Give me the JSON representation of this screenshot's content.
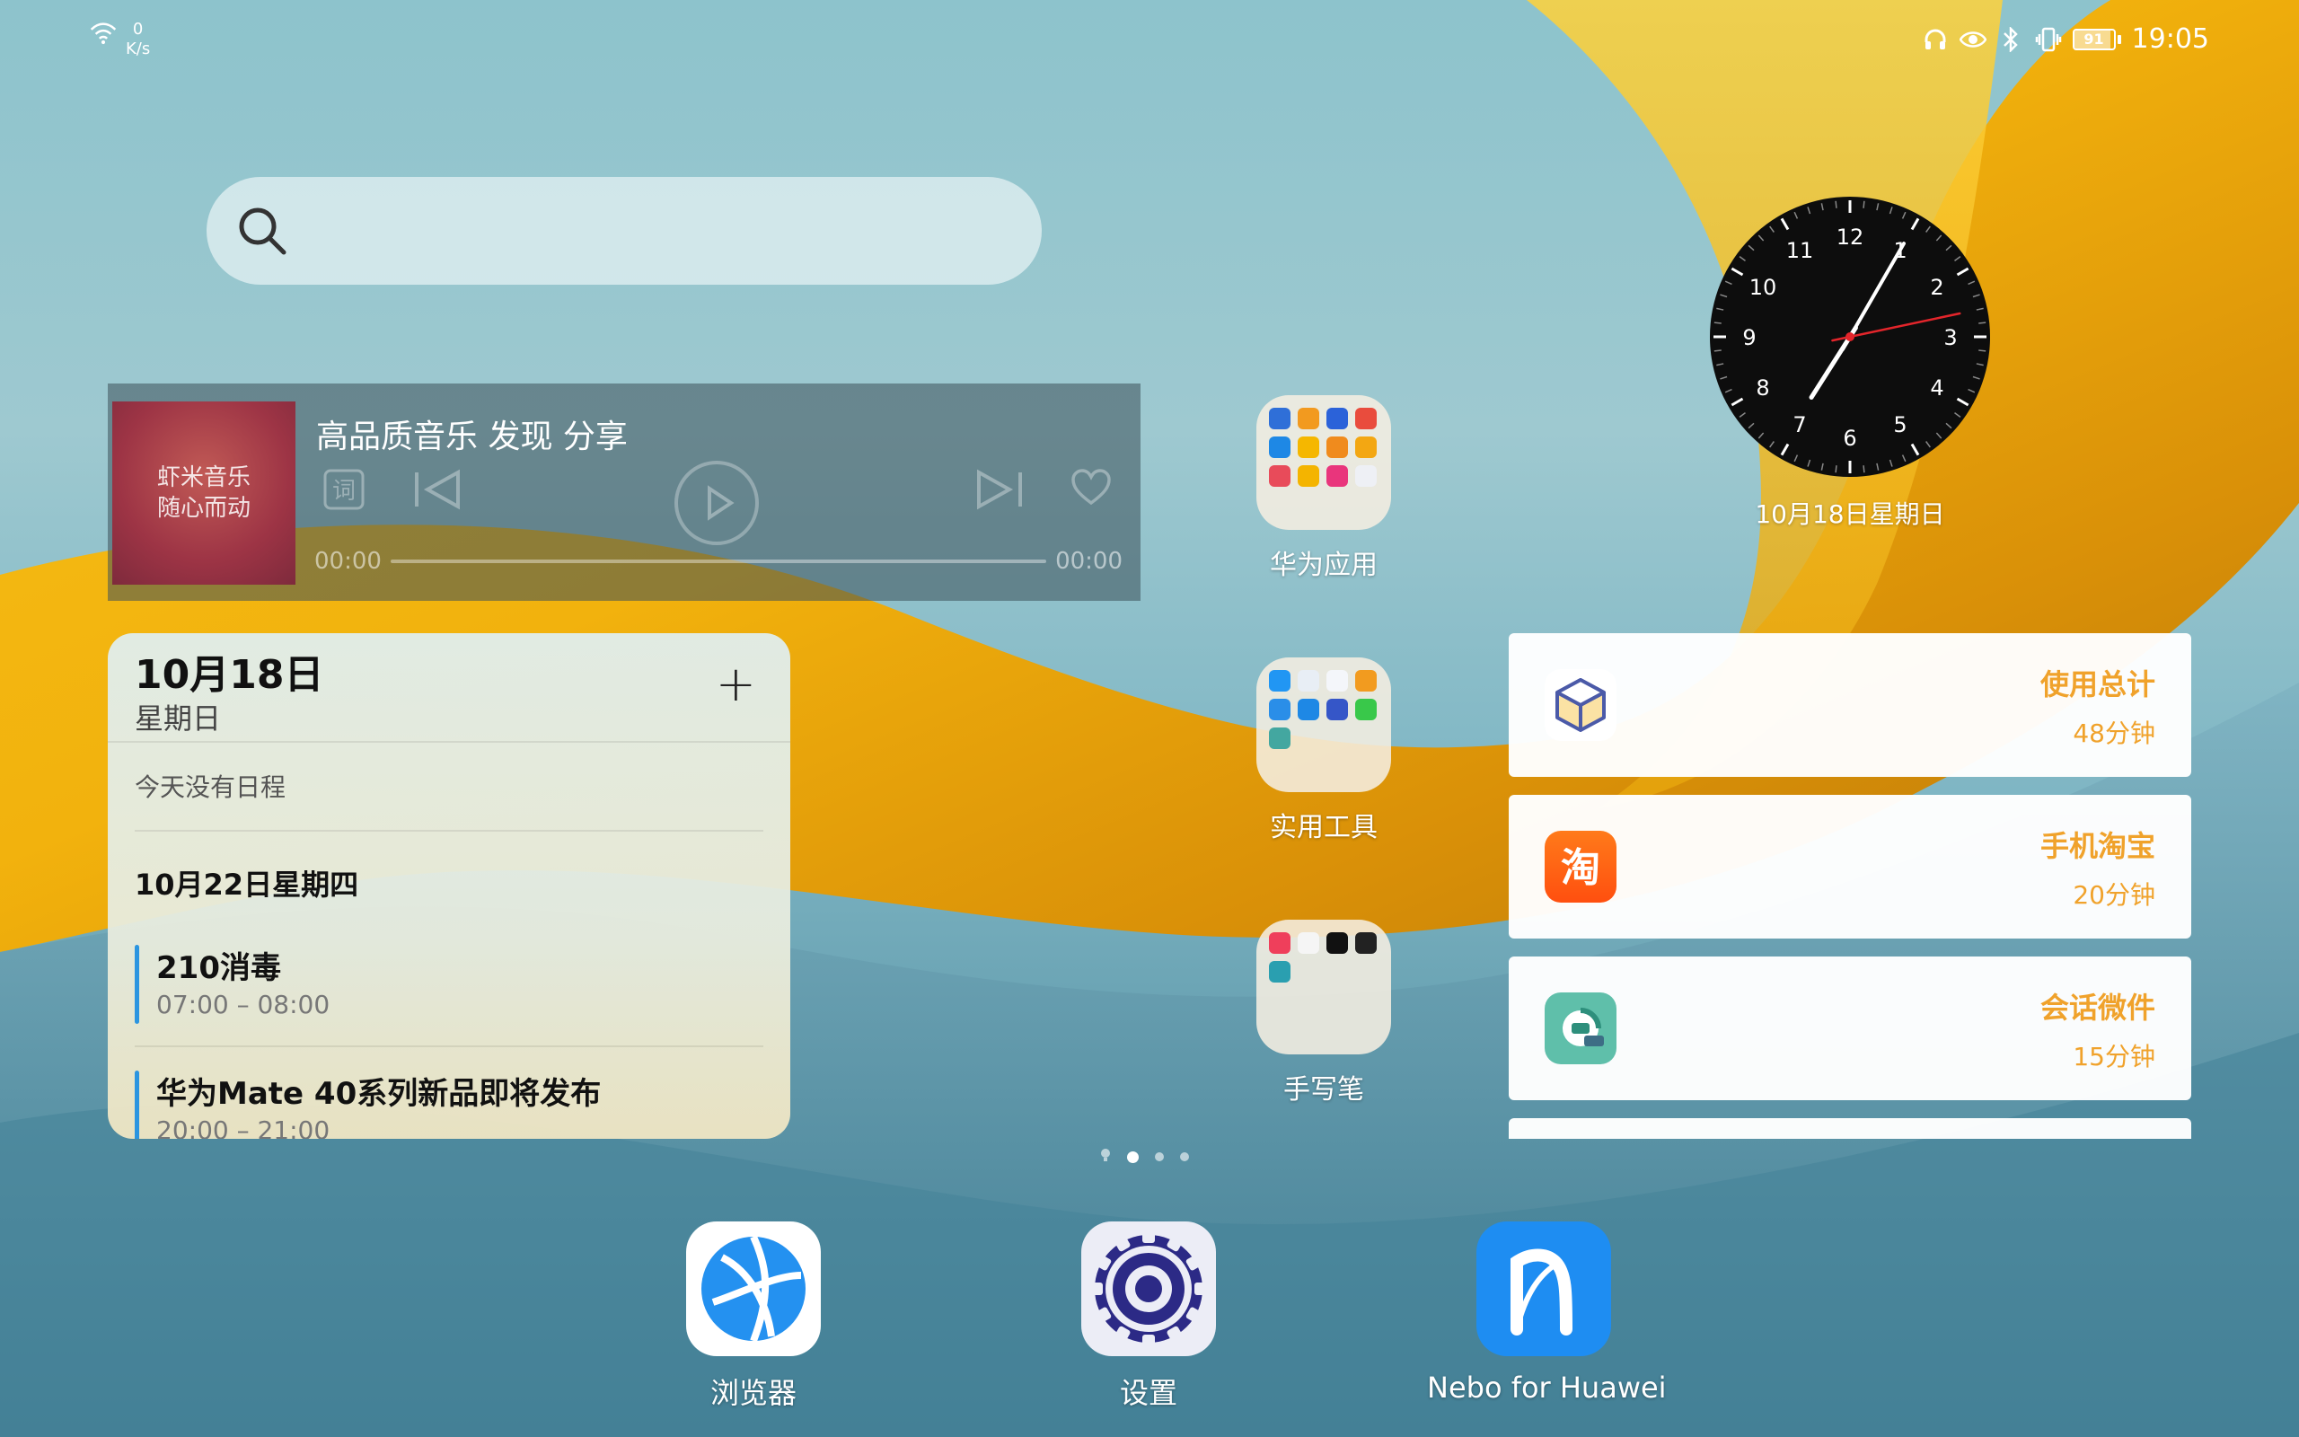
{
  "statusbar": {
    "net_speed_value": "0",
    "net_speed_unit": "K/s",
    "battery_level": "91",
    "battery_fraction": 0.91,
    "time": "19:05",
    "icons": [
      "wifi-icon",
      "headset-icon",
      "eye-comfort-icon",
      "bluetooth-icon",
      "vibrate-icon",
      "battery-icon"
    ]
  },
  "search": {
    "placeholder": ""
  },
  "music": {
    "cover_line1": "虾米音乐",
    "cover_line2": "随心而动",
    "title": "高品质音乐 发现 分享",
    "lyrics_label": "词",
    "time_current": "00:00",
    "time_total": "00:00",
    "progress": 0
  },
  "agenda": {
    "date": "10月18日",
    "weekday": "星期日",
    "add_label": "+",
    "no_events": "今天没有日程",
    "next_day": "10月22日星期四",
    "events": [
      {
        "title": "210消毒",
        "time": "07:00 – 08:00"
      },
      {
        "title": "华为Mate 40系列新品即将发布",
        "time": "20:00 – 21:00"
      }
    ]
  },
  "folders": [
    {
      "label": "华为应用"
    },
    {
      "label": "实用工具"
    },
    {
      "label": "手写笔"
    }
  ],
  "clock": {
    "date_label": "10月18日星期日",
    "time": "19:05"
  },
  "usage": {
    "items": [
      {
        "name": "使用总计",
        "duration": "48分钟",
        "icon": "cube-icon"
      },
      {
        "name": "手机淘宝",
        "duration": "20分钟",
        "icon": "taobao-icon",
        "icon_text": "淘"
      },
      {
        "name": "会话微件",
        "duration": "15分钟",
        "icon": "chat-widget-icon"
      }
    ],
    "accent": "#f0a22b"
  },
  "pages": {
    "count": 3,
    "active": 1
  },
  "dock": [
    {
      "label": "浏览器",
      "icon": "browser-icon"
    },
    {
      "label": "设置",
      "icon": "settings-gear-icon"
    },
    {
      "label": "Nebo for Huawei",
      "icon": "nebo-icon"
    }
  ]
}
